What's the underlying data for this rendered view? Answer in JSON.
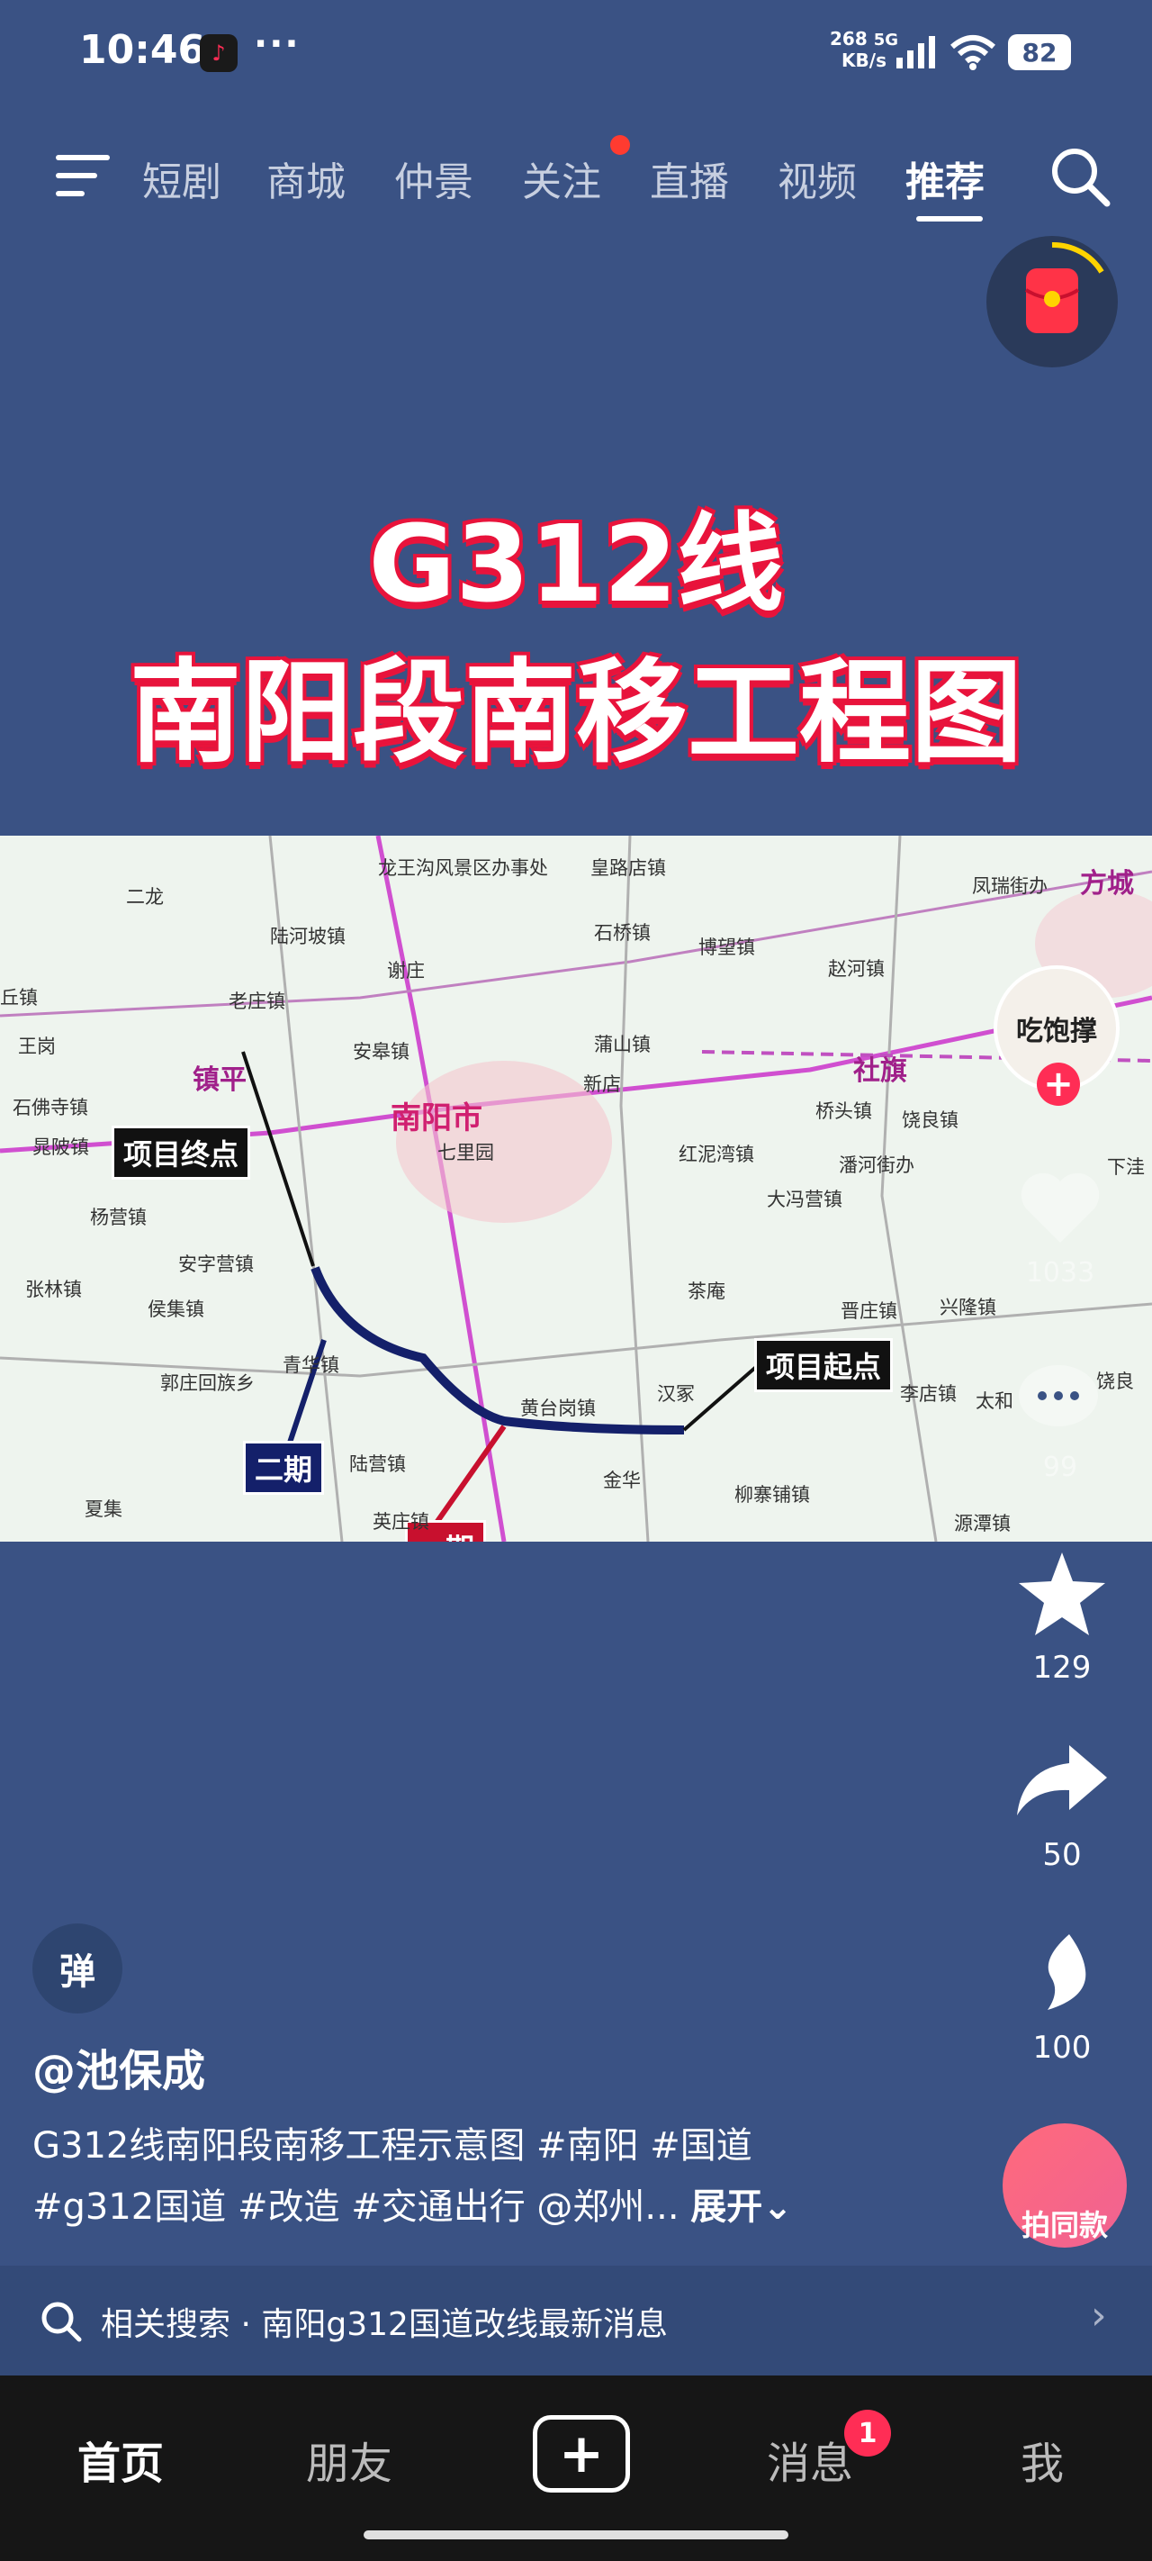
{
  "status_bar": {
    "time": "10:46",
    "dots": "···",
    "net_speed_value": "268",
    "net_speed_unit": "KB/s",
    "network": "5G",
    "battery": "82"
  },
  "top_nav": {
    "tabs": [
      "短剧",
      "商城",
      "仲景",
      "关注",
      "直播",
      "视频",
      "推荐"
    ],
    "active_tab": "推荐"
  },
  "video": {
    "title_line1": "G312线",
    "title_line2": "南阳段南移工程图",
    "map": {
      "city_label": "南阳市",
      "callout_end": "项目终点",
      "callout_start": "项目起点",
      "callout_phase2": "二期",
      "callout_phase1": "一期",
      "purple_labels": [
        "镇平",
        "社旗",
        "方城"
      ],
      "places": [
        "龙王沟风景区办事处",
        "皇路店镇",
        "二龙",
        "陆河坡镇",
        "石桥镇",
        "博望镇",
        "凤瑞街办",
        "丘镇",
        "老庄镇",
        "谢庄",
        "赵河镇",
        "王岗",
        "安皋镇",
        "蒲山镇",
        "石佛寺镇",
        "晁陂镇",
        "杨营镇",
        "新店",
        "桥头镇",
        "饶良镇",
        "潘河街办",
        "七里园",
        "红泥湾镇",
        "大冯营镇",
        "张林镇",
        "侯集镇",
        "安字营镇",
        "茶庵",
        "兴隆镇",
        "晋庄镇",
        "郭庄回族乡",
        "青华镇",
        "汉冢",
        "李店镇",
        "太和",
        "夏集",
        "陆营镇",
        "黄台岗镇",
        "金华",
        "柳寨铺镇",
        "英庄镇",
        "源潭镇",
        "下洼",
        "饶良"
      ]
    }
  },
  "actions": {
    "avatar_text": "吃饱撑",
    "like_count": "1033",
    "comment_count": "99",
    "favorite_count": "129",
    "share_count": "50",
    "misc_count": "100",
    "same_take_label": "拍同款"
  },
  "info": {
    "danmu": "弹",
    "author": "@池保成",
    "desc_line1": "G312线南阳段南移工程示意图 #南阳 #国道",
    "desc_line2": "#g312国道 #改造 #交通出行 @郑州...",
    "expand": "展开"
  },
  "related_search": {
    "prefix": "相关搜索",
    "separator": "·",
    "query": "南阳g312国道改线最新消息"
  },
  "bottom_nav": {
    "home": "首页",
    "friends": "朋友",
    "messages": "消息",
    "messages_badge": "1",
    "me": "我"
  },
  "colors": {
    "background": "#3a5284",
    "accent": "#ff2d55",
    "title_outline": "#e8143c",
    "route": "#14206a"
  }
}
